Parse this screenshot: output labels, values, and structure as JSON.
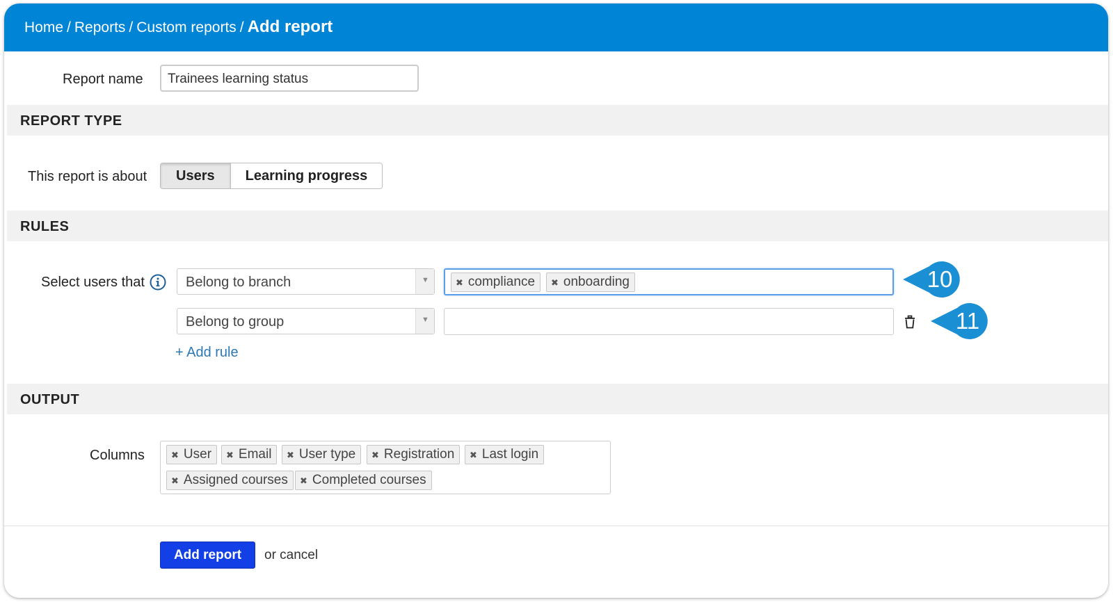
{
  "breadcrumb": {
    "items": [
      "Home",
      "Reports",
      "Custom reports"
    ],
    "separator": "/",
    "current": "Add report"
  },
  "report_name": {
    "label": "Report name",
    "value": "Trainees learning status"
  },
  "report_type": {
    "section_title": "REPORT TYPE",
    "label": "This report is about",
    "options": [
      "Users",
      "Learning progress"
    ],
    "selected": "Users"
  },
  "rules": {
    "section_title": "RULES",
    "label": "Select users that",
    "info_icon": "info-circle-icon",
    "rows": [
      {
        "condition": "Belong to branch",
        "values": [
          "compliance",
          "onboarding"
        ],
        "callout": "10"
      },
      {
        "condition": "Belong to group",
        "values": [],
        "callout": "11",
        "delete_icon": "trash-icon"
      }
    ],
    "add_rule_label": "+ Add rule"
  },
  "output": {
    "section_title": "OUTPUT",
    "columns_label": "Columns",
    "columns": [
      "User",
      "Email",
      "User type",
      "Registration",
      "Last login",
      "Assigned courses",
      "Completed courses"
    ]
  },
  "footer": {
    "submit_label": "Add report",
    "cancel_text": "or cancel"
  },
  "colors": {
    "header": "#0085d6",
    "primary_button": "#1240e6",
    "callout": "#1a8fd4",
    "link": "#2b78b5"
  }
}
